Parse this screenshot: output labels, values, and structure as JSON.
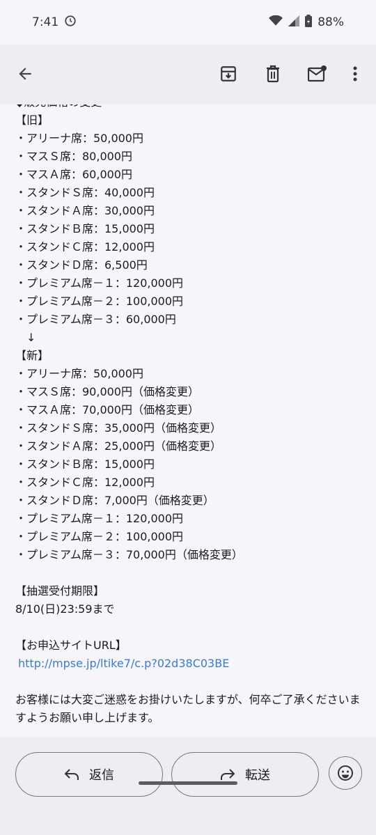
{
  "status_bar": {
    "time": "7:41",
    "battery": "88%"
  },
  "mail": {
    "truncated_heading": "◆販売価格の変更",
    "old_header": "【旧】",
    "old_items": [
      "・アリーナ席：50,000円",
      "・マスＳ席：80,000円",
      "・マスＡ席：60,000円",
      "・スタンドＳ席：40,000円",
      "・スタンドＡ席：30,000円",
      "・スタンドＢ席：15,000円",
      "・スタンドＣ席：12,000円",
      "・スタンドＤ席：6,500円",
      "・プレミアム席－１：120,000円",
      "・プレミアム席－２：100,000円",
      "・プレミアム席－３：60,000円"
    ],
    "arrow": "↓",
    "new_header": "【新】",
    "new_items": [
      "・アリーナ席：50,000円",
      "・マスＳ席：90,000円（価格変更）",
      "・マスＡ席：70,000円（価格変更）",
      "・スタンドＳ席：35,000円（価格変更）",
      "・スタンドＡ席：25,000円（価格変更）",
      "・スタンドＢ席：15,000円",
      "・スタンドＣ席：12,000円",
      "・スタンドＤ席：7,000円（価格変更）",
      "・プレミアム席－１：120,000円",
      "・プレミアム席－２：100,000円",
      "・プレミアム席－３：70,000円（価格変更）"
    ],
    "deadline_header": "【抽選受付期限】",
    "deadline_value": "8/10(日)23:59まで",
    "site_header": "【お申込サイトURL】",
    "site_url": "http://mpse.jp/ltike7/c.p?02d38C03BE",
    "apology": "お客様には大変ご迷惑をお掛けいたしますが、何卒ご了承くださいますようお願い申し上げます。",
    "divider": "--------------------------"
  },
  "actions": {
    "reply_label": "返信",
    "forward_label": "転送"
  },
  "colors": {
    "link": "#3a7bd5",
    "appbar_bg": "#eeedf3",
    "body_bg": "#f6f5fa"
  }
}
